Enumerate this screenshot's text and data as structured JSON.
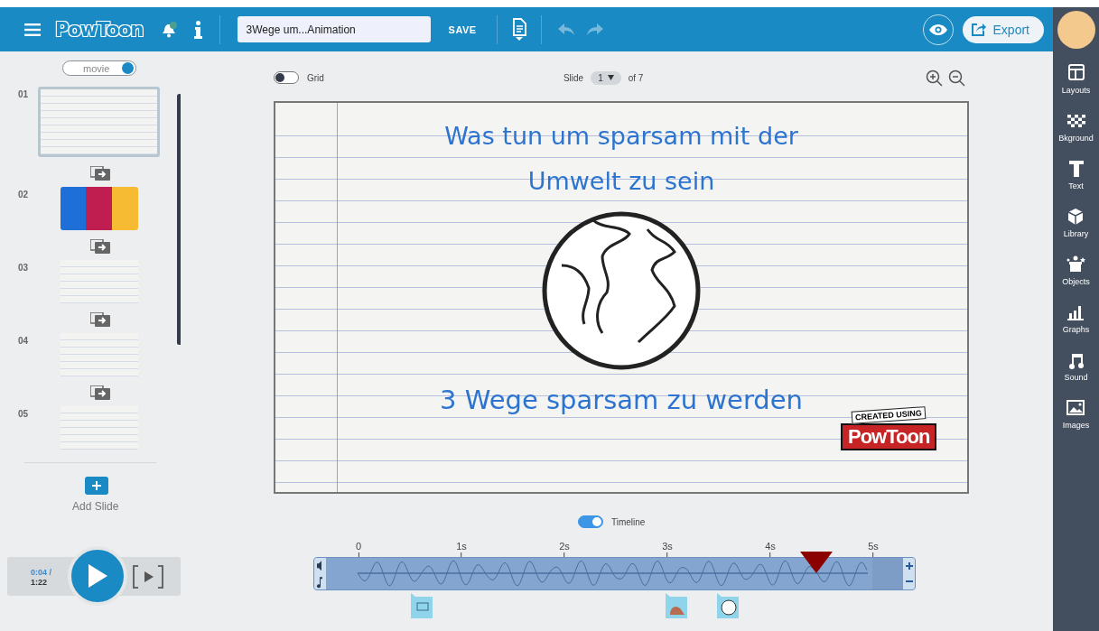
{
  "header": {
    "logo": "PowToon",
    "title_field": {
      "value": "3Wege um...Animation"
    },
    "save_button": "SAVE",
    "undo": {
      "disabled": true
    },
    "redo": {
      "disabled": true
    },
    "export_button": "Export"
  },
  "left_panel": {
    "movie_toggle": {
      "label": "movie",
      "on": true
    },
    "slides": [
      {
        "number": "01",
        "selected": true,
        "kind": "whiteboard"
      },
      {
        "number": "02",
        "selected": false,
        "kind": "characters"
      },
      {
        "number": "03",
        "selected": false,
        "kind": "whiteboard"
      },
      {
        "number": "04",
        "selected": false,
        "kind": "whiteboard"
      },
      {
        "number": "05",
        "selected": false,
        "kind": "whiteboard"
      }
    ],
    "add_slide": "Add Slide",
    "player": {
      "current": "0:04 /",
      "total": "1:22"
    }
  },
  "editor": {
    "grid_toggle": {
      "label": "Grid",
      "on": false
    },
    "slide_picker": {
      "label": "Slide",
      "value": "1",
      "of": "of 7"
    }
  },
  "slide": {
    "title_lines": [
      "Was tun um sparsam mit der",
      "Umwelt zu sein"
    ],
    "subtitle": "3 Wege sparsam zu werden",
    "badge": {
      "caption": "CREATED USING",
      "logo": "PowToon"
    }
  },
  "timeline": {
    "toggle": {
      "label": "Timeline",
      "on": true
    },
    "ticks": [
      "0",
      "1s",
      "2s",
      "3s",
      "4s",
      "5s"
    ],
    "playhead": {
      "level": 0.89
    }
  },
  "tools": [
    {
      "label": "Layouts",
      "kind": "layouts"
    },
    {
      "label": "Bkground",
      "kind": "background"
    },
    {
      "label": "Text",
      "kind": "text"
    },
    {
      "label": "Library",
      "kind": "library"
    },
    {
      "label": "Objects",
      "kind": "objects"
    },
    {
      "label": "Graphs",
      "kind": "graphs"
    },
    {
      "label": "Sound",
      "kind": "sound"
    },
    {
      "label": "Images",
      "kind": "images"
    }
  ]
}
